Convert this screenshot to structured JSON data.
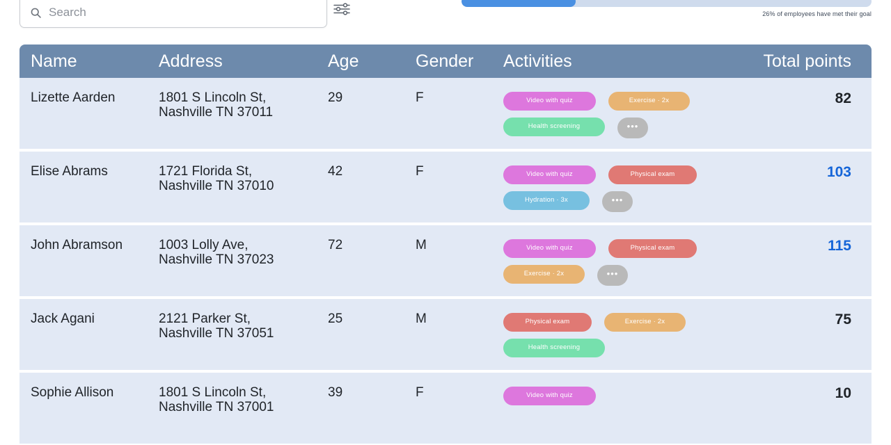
{
  "search": {
    "placeholder": "Search",
    "value": "",
    "icon": "search-icon"
  },
  "filter": {
    "icon": "filter-sliders-icon",
    "label": "Filter"
  },
  "progress": {
    "percent": 26,
    "fill_ratio_percent": 27.8,
    "caption": "26% of employees have met their goal",
    "fill_color": "#4a90e2",
    "track_color": "#cfdbed"
  },
  "table": {
    "header_color": "#6d8aac",
    "row_color": "#e2e9f5",
    "goal_met_color": "#1565d8",
    "columns": [
      {
        "key": "name",
        "label": "Name"
      },
      {
        "key": "address",
        "label": "Address"
      },
      {
        "key": "age",
        "label": "Age"
      },
      {
        "key": "gender",
        "label": "Gender"
      },
      {
        "key": "activities",
        "label": "Activities"
      },
      {
        "key": "points",
        "label": "Total points"
      }
    ],
    "more_label": "•••",
    "activity_colors": {
      "Video with quiz": "#dd77dd",
      "Exercise · 2x": "#e8b473",
      "Health screening": "#76e0ad",
      "Physical exam": "#e07974",
      "Hydration · 3x": "#77c0e0"
    },
    "rows": [
      {
        "name": "Lizette Aarden",
        "address": "1801 S Lincoln St,\nNashville TN 37011",
        "age": "29",
        "gender": "F",
        "activities": [
          "Video with quiz",
          "Exercise · 2x",
          "Health screening"
        ],
        "has_more": true,
        "points": "82",
        "goal_met": false
      },
      {
        "name": "Elise Abrams",
        "address": "1721 Florida St,\nNashville TN 37010",
        "age": "42",
        "gender": "F",
        "activities": [
          "Video with quiz",
          "Physical exam",
          "Hydration · 3x"
        ],
        "has_more": true,
        "points": "103",
        "goal_met": true
      },
      {
        "name": "John Abramson",
        "address": "1003 Lolly Ave,\nNashville TN 37023",
        "age": "72",
        "gender": "M",
        "activities": [
          "Video with quiz",
          "Physical exam",
          "Exercise · 2x"
        ],
        "has_more": true,
        "points": "115",
        "goal_met": true
      },
      {
        "name": "Jack Agani",
        "address": "2121 Parker St,\nNashville TN 37051",
        "age": "25",
        "gender": "M",
        "activities": [
          "Physical exam",
          "Exercise · 2x",
          "Health screening"
        ],
        "has_more": false,
        "points": "75",
        "goal_met": false
      },
      {
        "name": "Sophie Allison",
        "address": "1801 S Lincoln St,\nNashville TN 37001",
        "age": "39",
        "gender": "F",
        "activities": [
          "Video with quiz"
        ],
        "has_more": false,
        "points": "10",
        "goal_met": false
      }
    ]
  }
}
